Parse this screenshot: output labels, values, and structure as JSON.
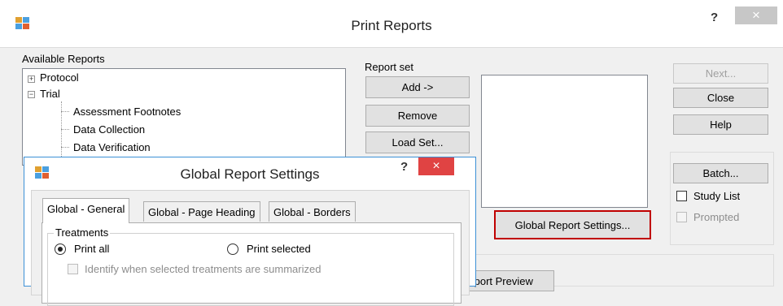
{
  "window": {
    "title": "Print Reports",
    "help_label": "?",
    "close_label": "×"
  },
  "available_reports": {
    "label": "Available Reports",
    "tree": [
      {
        "label": "Protocol",
        "expander": "+"
      },
      {
        "label": "Trial",
        "expander": "−"
      },
      {
        "label": "Assessment Footnotes"
      },
      {
        "label": "Data Collection"
      },
      {
        "label": "Data Verification"
      }
    ]
  },
  "report_set": {
    "label": "Report set",
    "add_label": "Add ->",
    "remove_label": "Remove",
    "load_set_label": "Load Set...",
    "global_settings_label": "Global Report Settings..."
  },
  "right_panel": {
    "next_label": "Next...",
    "close_label": "Close",
    "help_label": "Help",
    "batch_label": "Batch...",
    "study_list_label": "Study List",
    "prompted_label": "Prompted"
  },
  "partial_button_label": "Report Preview",
  "dialog": {
    "title": "Global Report Settings",
    "help_label": "?",
    "close_label": "×",
    "tabs": [
      "Global - General",
      "Global - Page Heading",
      "Global - Borders"
    ],
    "treatments": {
      "label": "Treatments",
      "print_all_label": "Print all",
      "print_selected_label": "Print selected",
      "identify_label": "Identify when selected treatments are summarized"
    }
  },
  "colors": {
    "dialog_border": "#3c90d6",
    "dialog_close": "#e04343",
    "highlight_border": "#c00000"
  }
}
